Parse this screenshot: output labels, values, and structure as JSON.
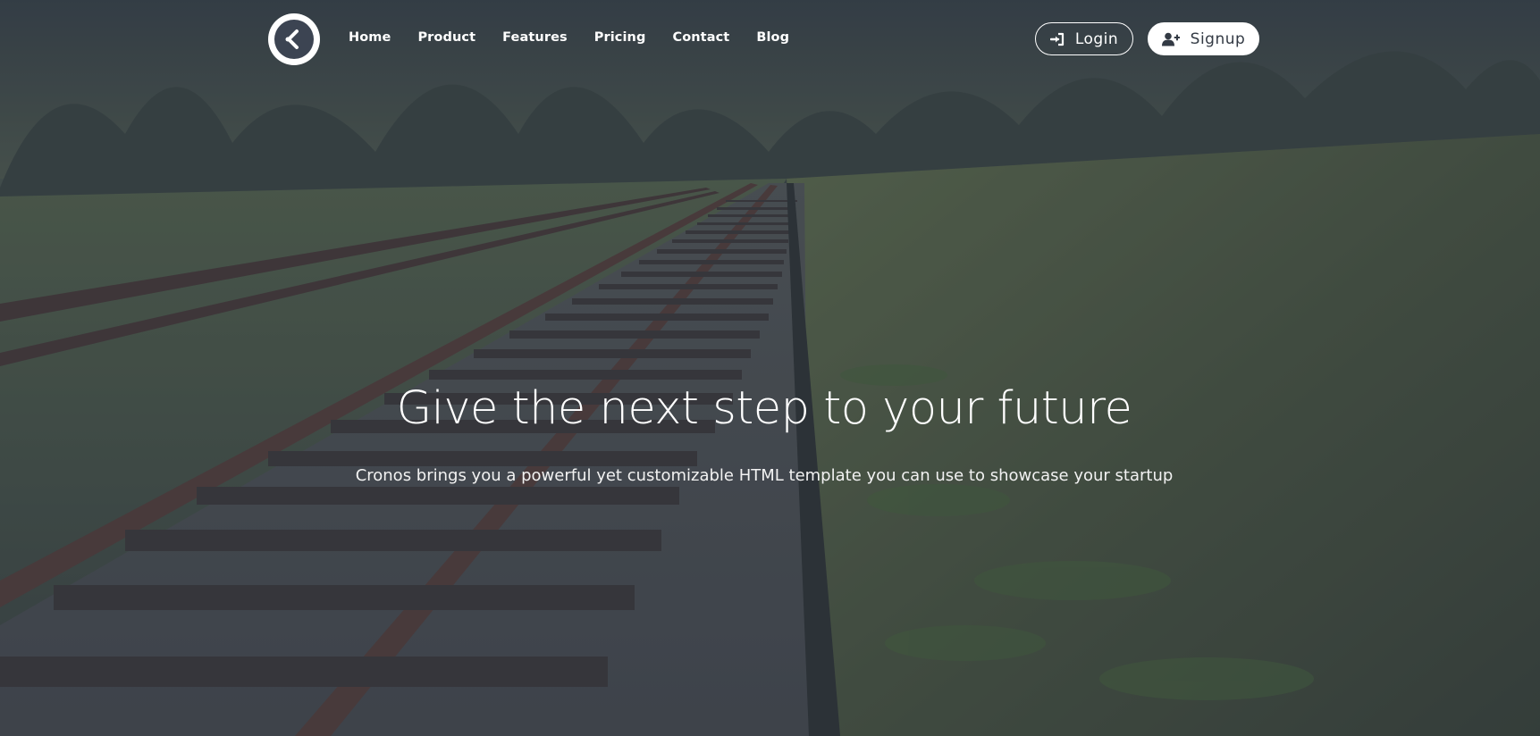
{
  "nav": {
    "logo_icon": "chevron-left-in-circle-icon",
    "links": [
      "Home",
      "Product",
      "Features",
      "Pricing",
      "Contact",
      "Blog"
    ]
  },
  "auth": {
    "login_label": "Login",
    "login_icon": "sign-in-icon",
    "signup_label": "Signup",
    "signup_icon": "user-plus-icon"
  },
  "hero": {
    "title": "Give the next step to your future",
    "subtitle": "Cronos brings you a powerful yet customizable HTML template you can use to showcase your startup"
  },
  "colors": {
    "overlay": "#283044",
    "text": "#ffffff",
    "signup_text": "#333a44"
  }
}
